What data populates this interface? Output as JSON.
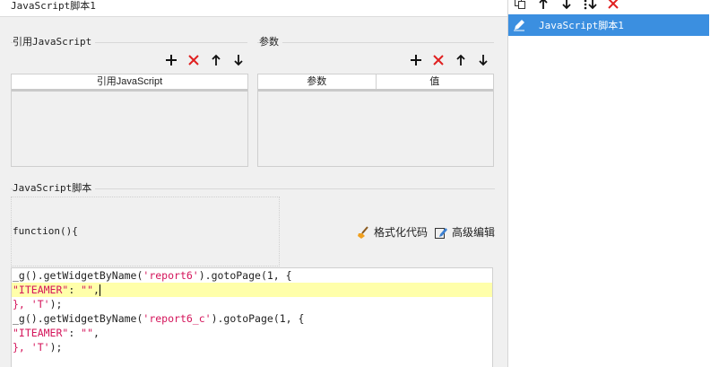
{
  "tab": {
    "title": "JavaScript脚本1"
  },
  "refs": {
    "section_title": "引用JavaScript",
    "columns": [
      "引用JavaScript"
    ]
  },
  "params": {
    "section_title": "参数",
    "columns": [
      "参数",
      "值"
    ]
  },
  "script": {
    "section_title": "JavaScript脚本",
    "function_label": "function(){",
    "format_label": "格式化代码",
    "advanced_label": "高级编辑",
    "code": {
      "l1a": "_g().getWidgetByName(",
      "l1s": "'report6'",
      "l1b": ").gotoPage(1, {",
      "l2s": "\"ITEAMER\"",
      "l2a": ": ",
      "l2e": "\"\"",
      "l2b": ",",
      "l3a": "}, ",
      "l3s": "'T'",
      "l3b": ");",
      "l4a": "_g().getWidgetByName(",
      "l4s": "'report6_c'",
      "l4b": ").gotoPage(1, {",
      "l5s": "\"ITEAMER\"",
      "l5a": ": ",
      "l5e": "\"\"",
      "l5b": ",",
      "l6a": "}, ",
      "l6s": "'T'",
      "l6b": ");"
    }
  },
  "right_list": {
    "items": [
      "JavaScript脚本1"
    ]
  },
  "icons": {
    "add": "plus-icon",
    "remove": "red-x-icon",
    "up": "arrow-up-icon",
    "down": "arrow-down-icon",
    "copy": "copy-icon",
    "edit": "pencil-icon",
    "broom": "broom-icon",
    "advanced": "edit-doc-icon",
    "sort": "sort-down-icon"
  },
  "colors": {
    "accent": "#3b8fe0",
    "remove": "#e02020",
    "highlight": "#ffffaa"
  }
}
